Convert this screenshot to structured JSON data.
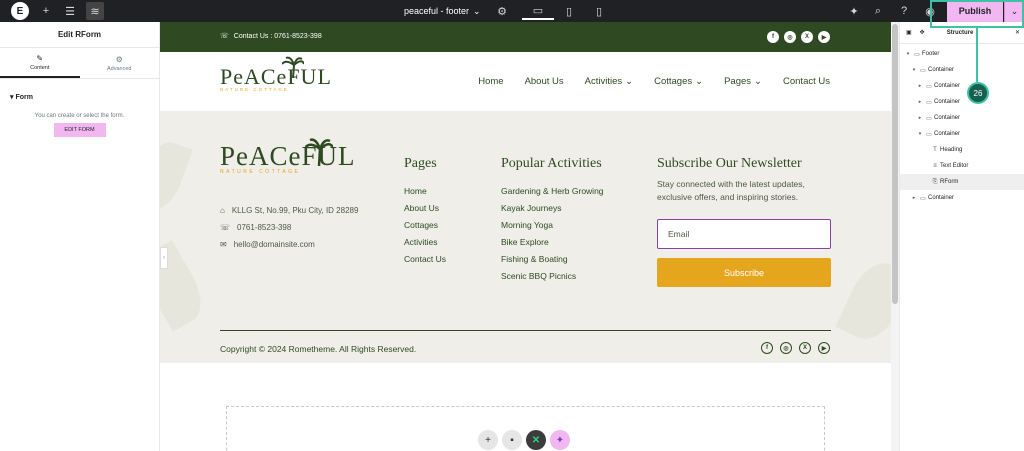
{
  "topbar": {
    "doc_title": "peaceful - footer",
    "publish_label": "Publish"
  },
  "left_panel": {
    "title": "Edit RForm",
    "tabs": [
      {
        "label": "Content"
      },
      {
        "label": "Advanced"
      }
    ],
    "section": "Form",
    "note": "You can create or select the form.",
    "edit_form_label": "EDIT FORM"
  },
  "site": {
    "contact_bar": "Contact Us : 0761-8523-398",
    "logo_word": "PeACeFUL",
    "logo_sub": "NATURE COTTAGE",
    "nav": [
      {
        "label": "Home"
      },
      {
        "label": "About Us"
      },
      {
        "label": "Activities"
      },
      {
        "label": "Cottages"
      },
      {
        "label": "Pages"
      },
      {
        "label": "Contact Us"
      }
    ],
    "footer": {
      "address": "KLLG St, No.99, Pku City, ID 28289",
      "phone": "0761-8523-398",
      "email": "hello@domainsite.com",
      "pages_title": "Pages",
      "pages": [
        "Home",
        "About Us",
        "Cottages",
        "Activities",
        "Contact Us"
      ],
      "activities_title": "Popular Activities",
      "activities": [
        "Gardening & Herb Growing",
        "Kayak Journeys",
        "Morning Yoga",
        "Bike Explore",
        "Fishing & Boating",
        "Scenic BBQ Picnics"
      ],
      "newsletter_title": "Subscribe Our Newsletter",
      "newsletter_desc": "Stay connected with the latest updates, exclusive offers, and inspiring stories.",
      "email_placeholder": "Email",
      "subscribe_label": "Subscribe",
      "copyright": "Copyright © 2024 Rometheme. All Rights Reserved."
    }
  },
  "structure": {
    "title": "Structure",
    "items": [
      {
        "label": "Footer"
      },
      {
        "label": "Container"
      },
      {
        "label": "Container"
      },
      {
        "label": "Container"
      },
      {
        "label": "Container"
      },
      {
        "label": "Container"
      },
      {
        "label": "Heading"
      },
      {
        "label": "Text Editor"
      },
      {
        "label": "RForm"
      },
      {
        "label": "Container"
      }
    ]
  },
  "badge": "26",
  "colors": {
    "brand_green": "#2f4a23",
    "accent_gold": "#e5a51c",
    "publish_pink": "#f0b7f0",
    "highlight": "#3ec1a5"
  }
}
